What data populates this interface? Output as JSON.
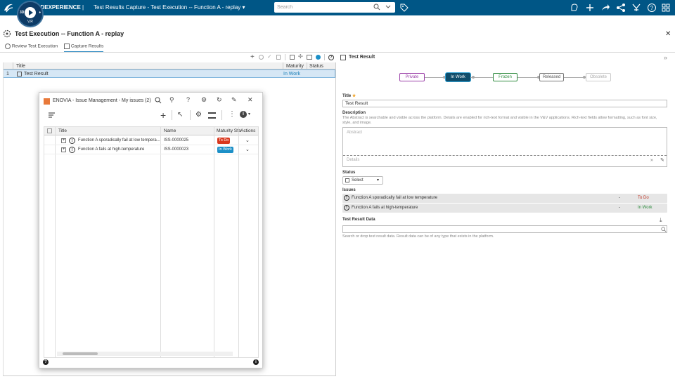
{
  "topbar": {
    "brand": "3DEXPERIENCE",
    "title": "Test Results Capture - Test Execution -- Function A - replay",
    "search_placeholder": "Search",
    "compass_label": "V,R"
  },
  "header": {
    "page_title": "Test Execution -- Function A - replay",
    "tabs": [
      {
        "label": "Review Test Execution"
      },
      {
        "label": "Capture Results"
      }
    ]
  },
  "left_grid": {
    "columns": [
      "Title",
      "Maturity",
      "Status"
    ],
    "rows": [
      {
        "num": "1",
        "title": "Test Result",
        "maturity": "In Work",
        "status": ""
      }
    ]
  },
  "right_panel": {
    "title": "Test Result",
    "lifecycle": [
      "Private",
      "In Work",
      "Frozen",
      "Released",
      "Obsolete"
    ],
    "title_label": "Title",
    "title_value": "Test Result",
    "description_label": "Description",
    "description_help": "The Abstract is searchable and visible across the platform. Details are enabled for rich-text format and visible in the V&V applications. Rich-text fields allow formatting, such as font size, style, and image.",
    "abstract_placeholder": "Abstract",
    "details_placeholder": "Details",
    "status_label": "Status",
    "status_value": "Select",
    "issues_label": "Issues",
    "issues": [
      {
        "title": "Function A sporadically fail at low temperature",
        "dash": "-",
        "state": "To Do"
      },
      {
        "title": "Function A fails at high-temperature",
        "dash": "-",
        "state": "In Work"
      }
    ],
    "data_label": "Test Result Data",
    "data_help": "Search or drop test result data. Result data can be of any type that exists in the platform."
  },
  "issue_panel": {
    "title": "ENOVIA - Issue Management - My issues (2)",
    "columns": [
      "Title",
      "Name",
      "Maturity Sta",
      "Actions"
    ],
    "rows": [
      {
        "title": "Function A sporadically fail at low tempera...",
        "name": "ISS-0000025",
        "maturity": "To Do"
      },
      {
        "title": "Function A fails at high-temperature",
        "name": "ISS-0000023",
        "maturity": "In Work"
      }
    ]
  },
  "colors": {
    "topbar": "#005686",
    "todo": "#d9381e",
    "inwork": "#1b8fc7",
    "frozen_green": "#2e8b3e"
  }
}
